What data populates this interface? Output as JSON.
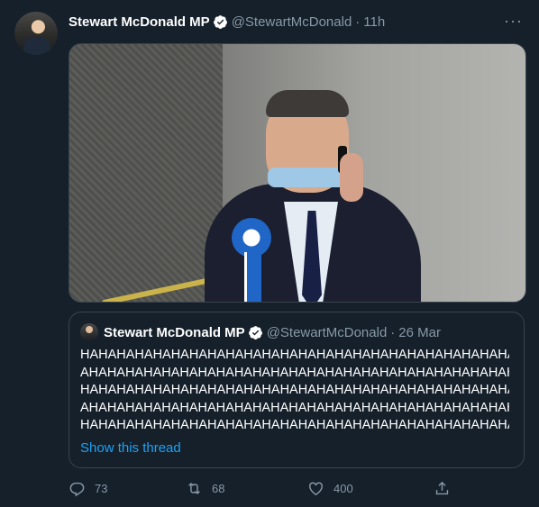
{
  "tweet": {
    "author_name": "Stewart McDonald MP",
    "handle": "@StewartMcDonald",
    "separator": "·",
    "time": "11h",
    "more_label": "···"
  },
  "quoted": {
    "author_name": "Stewart McDonald MP",
    "handle": "@StewartMcDonald",
    "separator": "·",
    "date": "26 Mar",
    "lines": [
      "HAHAHAHAHAHAHAHAHAHAHAHAHAHAHAHAHAHAHAHAHAHAHAHAH",
      "AHAHAHAHAHAHAHAHAHAHAHAHAHAHAHAHAHAHAHAHAHAHAHAHA",
      "HAHAHAHAHAHAHAHAHAHAHAHAHAHAHAHAHAHAHAHAHAHAHAHAH",
      "AHAHAHAHAHAHAHAHAHAHAHAHAHAHAHAHAHAHAHAHAHAHAHAHA",
      "HAHAHAHAHAHAHAHAHAHAHAHAHAHAHAHAHAHAHAHAHAHAHAHA..."
    ],
    "show_thread": "Show this thread"
  },
  "actions": {
    "reply_count": "73",
    "retweet_count": "68",
    "like_count": "400"
  },
  "colors": {
    "background": "#15202b",
    "secondary_text": "#8899a6",
    "link": "#1da1f2",
    "border": "#38444d"
  },
  "icons": [
    "verified-badge-icon",
    "more-icon",
    "reply-icon",
    "retweet-icon",
    "like-icon",
    "share-icon"
  ]
}
